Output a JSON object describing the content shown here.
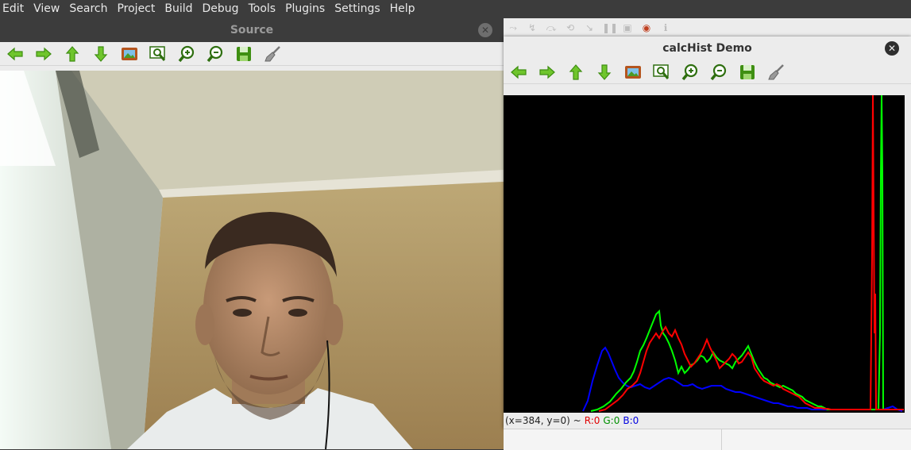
{
  "menu": [
    "Edit",
    "View",
    "Search",
    "Project",
    "Build",
    "Debug",
    "Tools",
    "Plugins",
    "Settings",
    "Help"
  ],
  "source_window": {
    "title": "Source",
    "close_icon": "close-icon"
  },
  "toolbar_icons": [
    "arrow-left-icon",
    "arrow-right-icon",
    "arrow-up-icon",
    "arrow-down-icon",
    "image-icon",
    "zoom-fit-icon",
    "zoom-in-icon",
    "zoom-out-icon",
    "save-icon",
    "brush-icon"
  ],
  "hist_window": {
    "title": "calcHist Demo",
    "status": {
      "coords": "(x=384, y=0) ~",
      "r": "R:0",
      "g": "G:0",
      "b": "B:0"
    }
  },
  "colors": {
    "red": "#ff0000",
    "green": "#00ff00",
    "blue": "#0000ff",
    "accent_green": "#4a9c1e"
  }
}
